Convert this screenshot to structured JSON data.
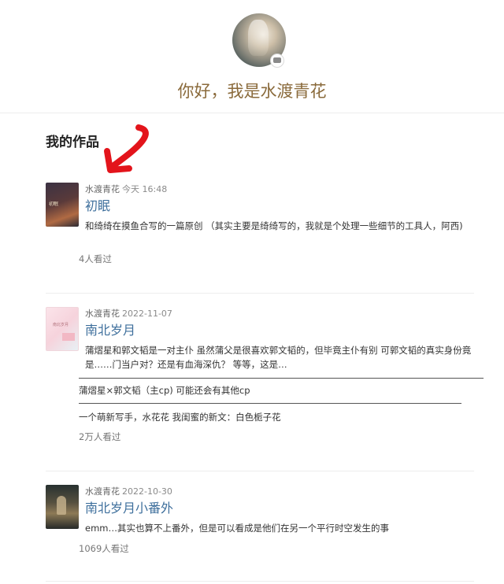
{
  "profile": {
    "greeting": "你好，我是水渡青花"
  },
  "section_title": "我的作品",
  "works": [
    {
      "author": "水渡青花",
      "time": "今天 16:48",
      "title": "初眠",
      "cover_text": "初眠",
      "description": "和绮绮在摸鱼合写的一篇原创 （其实主要是绮绮写的，我就是个处理一些细节的工具人，阿西)",
      "views": "4人看过"
    },
    {
      "author": "水渡青花",
      "time": "2022-11-07",
      "title": "南北岁月",
      "cover_text": "南北岁月",
      "description": "蒲熠星和郭文韬是一对主仆 虽然蒲父是很喜欢郭文韬的，但毕竟主仆有别 可郭文韬的真实身份竟是……门当户对？还是有血海深仇？ 等等，这是…",
      "extra_line_1": "蒲熠星×郭文韬（主cp) 可能还会有其他cp",
      "extra_line_2": "一个萌新写手，水花花 我闺蜜的新文：白色栀子花",
      "views": "2万人看过"
    },
    {
      "author": "水渡青花",
      "time": "2022-10-30",
      "title": "南北岁月小番外",
      "description": "emm…其实也算不上番外，但是可以看成是他们在另一个平行时空发生的事",
      "views": "1069人看过"
    }
  ],
  "colors": {
    "greeting": "#8a6a3b",
    "title_link": "#3e6f9c",
    "arrow": "#e3141b"
  }
}
